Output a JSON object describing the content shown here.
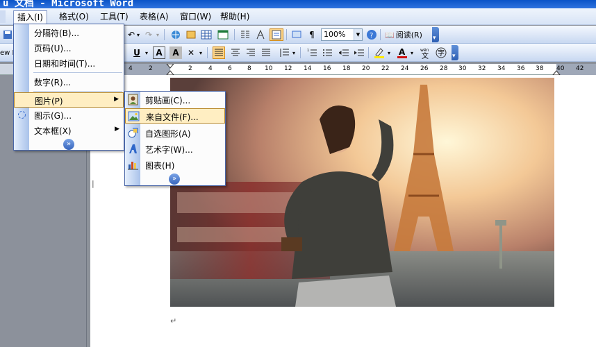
{
  "titlebar": {
    "text": "u 文档 - Microsoft Word"
  },
  "menubar": {
    "items": [
      {
        "label": "插入(I)",
        "active": true
      },
      {
        "label": "格式(O)"
      },
      {
        "label": "工具(T)"
      },
      {
        "label": "表格(A)"
      },
      {
        "label": "窗口(W)"
      },
      {
        "label": "帮助(H)"
      }
    ]
  },
  "toolbar": {
    "zoom": "100%",
    "read_label": "阅读(R)",
    "style_combo": "ew B"
  },
  "ruler": {
    "numbers": [
      "4",
      "2",
      "2",
      "4",
      "6",
      "8",
      "10",
      "12",
      "14",
      "16",
      "18",
      "20",
      "22",
      "24",
      "26",
      "28",
      "30",
      "32",
      "34",
      "36",
      "38",
      "40",
      "42"
    ]
  },
  "insert_menu": {
    "items": [
      {
        "label": "分隔符(B)..."
      },
      {
        "label": "页码(U)..."
      },
      {
        "label": "日期和时间(T)..."
      },
      {
        "label": "数字(R)..."
      },
      {
        "label": "图片(P)",
        "highlighted": true,
        "has_submenu": true
      },
      {
        "label": "图示(G)..."
      },
      {
        "label": "文本框(X)",
        "has_submenu": true
      }
    ]
  },
  "picture_submenu": {
    "items": [
      {
        "label": "剪贴画(C)...",
        "icon": "clipart-icon"
      },
      {
        "label": "来自文件(F)...",
        "icon": "picture-from-file-icon",
        "highlighted": true
      },
      {
        "label": "自选图形(A)",
        "icon": "autoshapes-icon"
      },
      {
        "label": "艺术字(W)...",
        "icon": "wordart-icon"
      },
      {
        "label": "图表(H)",
        "icon": "chart-icon"
      }
    ]
  },
  "colors": {
    "menu_highlight": "#ffeec2",
    "toolbar_pressed": "#fcd488",
    "titlebar": "#0a54c8"
  }
}
